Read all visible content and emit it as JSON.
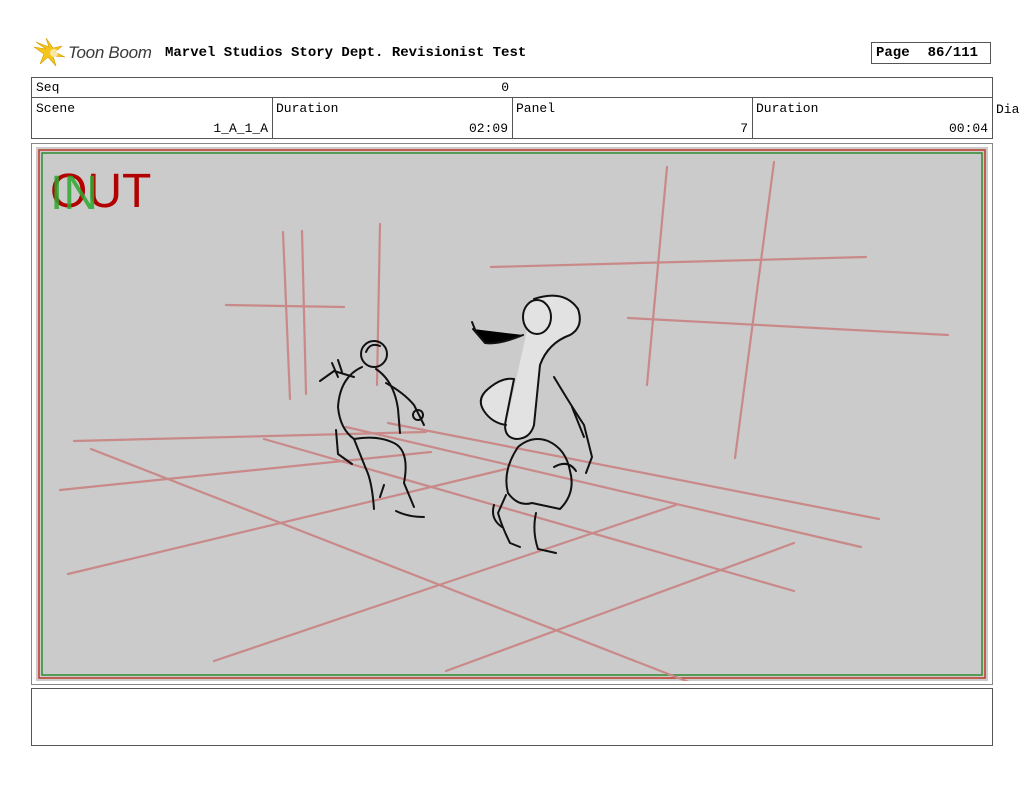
{
  "header": {
    "logo_text": "Toon Boom",
    "title": "Marvel Studios Story Dept. Revisionist Test",
    "page_label": "Page",
    "page_value": "86/111"
  },
  "info": {
    "seq_label": "Seq",
    "seq_value": "0",
    "scene_label": "Scene",
    "scene_value": "1_A_1_A",
    "duration_label": "Duration",
    "duration_value": "02:09",
    "panel_label": "Panel",
    "panel_value": "7",
    "panel_duration_label": "Duration",
    "panel_duration_value": "00:04",
    "dialog_label": "Dia"
  },
  "panel": {
    "in_marker": "IN",
    "out_marker": "OUT",
    "colors": {
      "background": "#cbcbcb",
      "guide_lines": "#c98989",
      "out_marker": "#b30000",
      "in_marker": "#2ea82e",
      "frame_red": "#c0392b",
      "frame_green": "#2e8b2e"
    }
  },
  "notes": {
    "text": ""
  }
}
